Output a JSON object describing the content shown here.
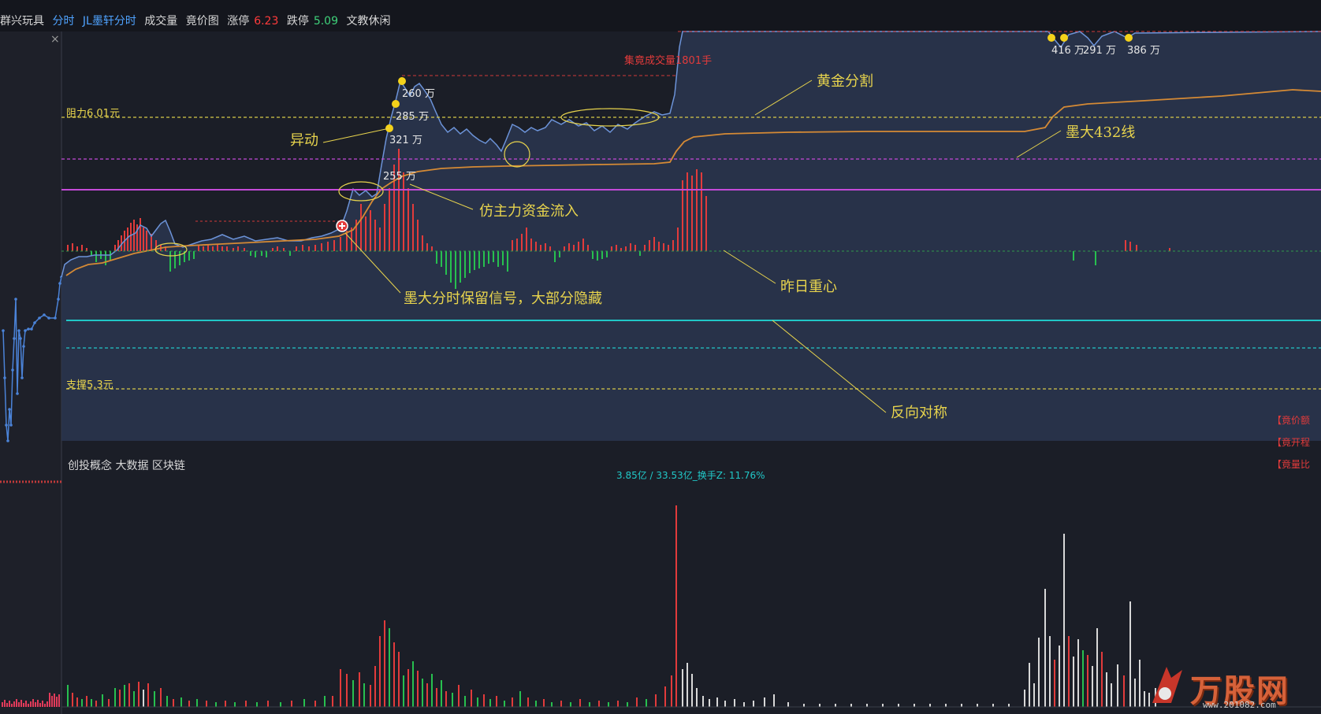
{
  "header": {
    "stock_name": "群兴玩具",
    "tab_fenshi": "分时",
    "tab_jl": "JL墨轩分时",
    "tab_volume": "成交量",
    "tab_auction": "竟价图",
    "limit_up_label": "涨停",
    "limit_up_value": "6.23",
    "limit_down_label": "跌停",
    "limit_down_value": "5.09",
    "industry": "文教休闲"
  },
  "colors": {
    "price_line": "#6c93d8",
    "avg_line": "#d58a35",
    "up_bar": "#e23b3b",
    "down_bar": "#27c04f",
    "annotation": "#e8d44d",
    "magenta": "#c44ad8",
    "cyan": "#21c7c7"
  },
  "price_chart": {
    "resistance_label": "阻力6.01元",
    "support_label": "支撑5.3元",
    "auction_volume_label": "集竟成交量1801手",
    "big_orders": [
      "260 万",
      "285 万",
      "321 万",
      "255 万",
      "416 万",
      "291 万",
      "386 万"
    ],
    "right_tags": [
      "【竟价额",
      "【竟开程",
      "【竟量比"
    ],
    "close_icon": "×"
  },
  "annotations": {
    "yidong": "异动",
    "golden_split": "黄金分割",
    "mo432": "墨大432线",
    "fund_inflow": "仿主力资金流入",
    "signal_note": "墨大分时保留信号，大部分隐藏",
    "yesterday_center": "昨日重心",
    "reverse_symmetry": "反向对称"
  },
  "volume_panel": {
    "concepts": "创投概念 大数据 区块链",
    "turnover": "3.85亿 / 33.53亿_换手Z: 11.76%"
  },
  "watermark": {
    "brand": "万股网",
    "url": "www.201082.com"
  },
  "chart_data": {
    "type": "line",
    "title": "群兴玩具 分时",
    "limit_up": 6.23,
    "limit_down": 5.09,
    "resistance": 6.01,
    "support": 5.3,
    "auction_volume_lots": 1801,
    "turnover": "3.85亿 / 33.53亿",
    "turnover_rate_pct": 11.76,
    "big_order_annotations_wan": [
      260,
      285,
      321,
      255,
      416,
      291,
      386
    ],
    "price_series_approx": [
      5.62,
      5.66,
      5.72,
      5.74,
      5.76,
      5.76,
      5.77,
      5.78,
      5.78,
      5.79,
      5.85,
      5.9,
      5.95,
      6.05,
      6.12,
      6.02,
      5.96,
      5.95,
      5.99,
      6.0,
      6.23,
      6.23,
      6.23,
      6.23
    ]
  }
}
